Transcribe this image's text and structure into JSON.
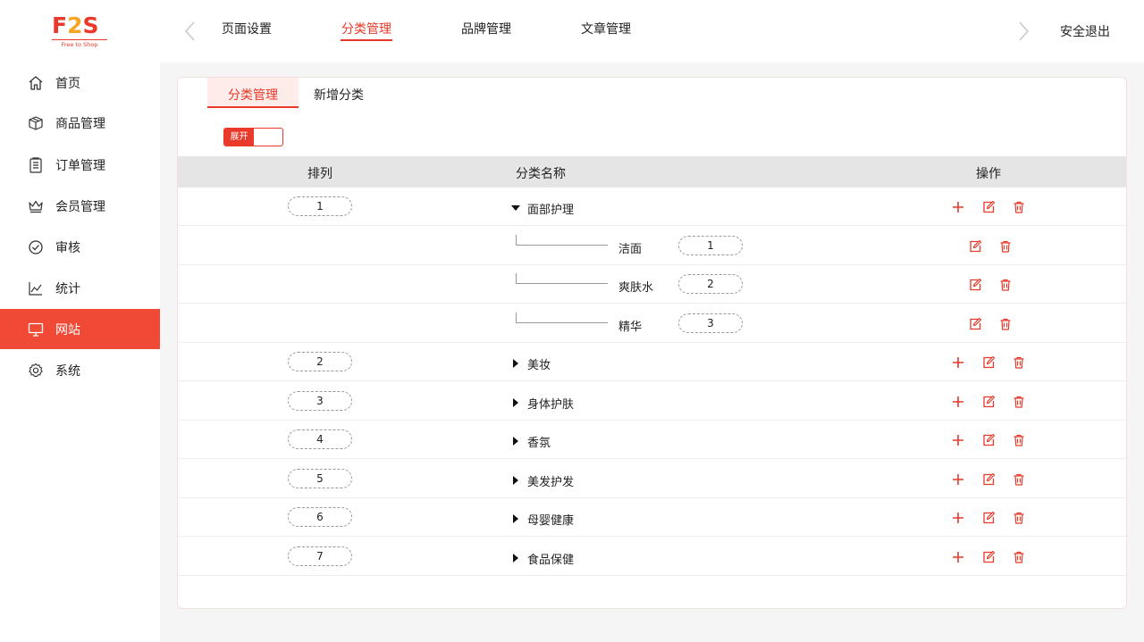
{
  "logo": {
    "tagline": "Free to Shop",
    "mark": [
      "F",
      "2",
      "S"
    ]
  },
  "top_nav": [
    {
      "label": "页面设置",
      "active": false
    },
    {
      "label": "分类管理",
      "active": true
    },
    {
      "label": "品牌管理",
      "active": false
    },
    {
      "label": "文章管理",
      "active": false
    }
  ],
  "logout_label": "安全退出",
  "sidebar": [
    {
      "label": "首页",
      "icon": "home-icon",
      "active": false
    },
    {
      "label": "商品管理",
      "icon": "box-icon",
      "active": false
    },
    {
      "label": "订单管理",
      "icon": "clipboard-icon",
      "active": false
    },
    {
      "label": "会员管理",
      "icon": "crown-icon",
      "active": false
    },
    {
      "label": "审核",
      "icon": "check-circle-icon",
      "active": false
    },
    {
      "label": "统计",
      "icon": "line-chart-icon",
      "active": false
    },
    {
      "label": "网站",
      "icon": "monitor-icon",
      "active": true
    },
    {
      "label": "系统",
      "icon": "gear-icon",
      "active": false
    }
  ],
  "subtabs": [
    {
      "label": "分类管理",
      "active": true
    },
    {
      "label": "新增分类",
      "active": false
    }
  ],
  "toggle_label": "展开",
  "table": {
    "headers": [
      "排列",
      "分类名称",
      "操作"
    ],
    "rows": [
      {
        "order": "1",
        "name": "面部护理",
        "expanded": true,
        "children": [
          {
            "name": "洁面",
            "order": "1"
          },
          {
            "name": "爽肤水",
            "order": "2"
          },
          {
            "name": "精华",
            "order": "3"
          }
        ]
      },
      {
        "order": "2",
        "name": "美妆",
        "expanded": false
      },
      {
        "order": "3",
        "name": "身体护肤",
        "expanded": false
      },
      {
        "order": "4",
        "name": "香氛",
        "expanded": false
      },
      {
        "order": "5",
        "name": "美发护发",
        "expanded": false
      },
      {
        "order": "6",
        "name": "母婴健康",
        "expanded": false
      },
      {
        "order": "7",
        "name": "食品保健",
        "expanded": false
      }
    ]
  },
  "colors": {
    "accent": "#e8392a",
    "sidebar_active": "#f04a36",
    "header_row": "#e5e5e5"
  }
}
